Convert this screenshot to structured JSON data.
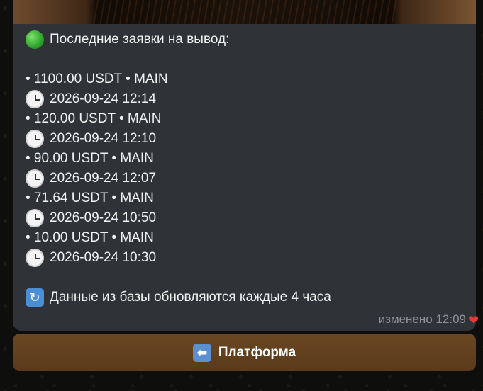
{
  "message": {
    "header": "Последние заявки на вывод:",
    "withdrawals": [
      {
        "line": "• 1100.00 USDT • MAIN",
        "time": "2026-09-24 12:14"
      },
      {
        "line": "• 120.00 USDT • MAIN",
        "time": "2026-09-24 12:10"
      },
      {
        "line": "• 90.00 USDT • MAIN",
        "time": "2026-09-24 12:07"
      },
      {
        "line": "• 71.64 USDT • MAIN",
        "time": "2026-09-24 10:50"
      },
      {
        "line": "• 10.00 USDT • MAIN",
        "time": "2026-09-24 10:30"
      }
    ],
    "footer_note": "Данные из базы обновляются каждые 4 часа",
    "edited_meta": "изменено 12:09",
    "reaction": "❤"
  },
  "keyboard": {
    "platform_label": "Платформа",
    "platform_icon": "⬅"
  },
  "icons": {
    "header": "green-circle-icon",
    "time": "clock-icon",
    "footer": "refresh-icon",
    "reaction": "heart-icon",
    "button": "left-arrow-icon"
  }
}
